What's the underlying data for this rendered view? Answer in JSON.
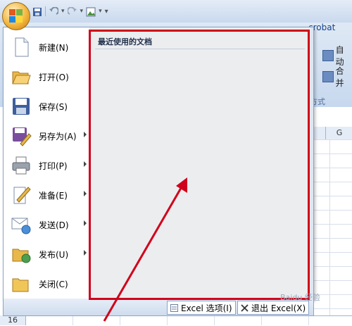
{
  "ribbon": {
    "partial_title": "crobat",
    "right_buttons": [
      "自动",
      "合并"
    ],
    "group_label": "方式",
    "column_header": "G"
  },
  "sheet": {
    "row_number": "16"
  },
  "quick_access": {
    "icons": [
      "save-icon",
      "undo-icon",
      "redo-icon",
      "picture-icon",
      "customize-icon"
    ]
  },
  "menu": {
    "commands": [
      {
        "label": "新建(N)",
        "icon": "new-document-icon",
        "submenu": false
      },
      {
        "label": "打开(O)",
        "icon": "open-folder-icon",
        "submenu": false
      },
      {
        "label": "保存(S)",
        "icon": "save-disk-icon",
        "submenu": false
      },
      {
        "label": "另存为(A)",
        "icon": "save-as-icon",
        "submenu": true
      },
      {
        "label": "打印(P)",
        "icon": "printer-icon",
        "submenu": true
      },
      {
        "label": "准备(E)",
        "icon": "prepare-icon",
        "submenu": true
      },
      {
        "label": "发送(D)",
        "icon": "send-icon",
        "submenu": true
      },
      {
        "label": "发布(U)",
        "icon": "publish-icon",
        "submenu": true
      },
      {
        "label": "关闭(C)",
        "icon": "close-folder-icon",
        "submenu": false
      }
    ],
    "recent_title": "最近使用的文档",
    "footer": {
      "options_label": "Excel 选项(I)",
      "exit_label": "退出 Excel(X)"
    }
  },
  "watermark": "Baidu 经验",
  "colors": {
    "highlight": "#d0021b",
    "menu_bg": "#dde6f3"
  }
}
